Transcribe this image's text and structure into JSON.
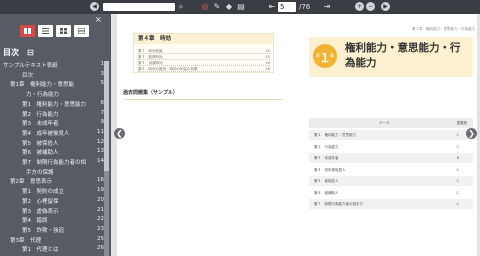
{
  "toolbar": {
    "page_number": "5",
    "page_total": "/76"
  },
  "sidebar": {
    "close_glyph": "×",
    "title": "目次",
    "toc": [
      {
        "label": "サンプルテキスト表紙",
        "page": "1",
        "indent": 0,
        "box": true
      },
      {
        "label": "目次",
        "page": "3",
        "indent": 2,
        "box": false
      },
      {
        "label": "第1章　権利能力・意思能",
        "page": "5",
        "indent": 1,
        "box": true
      },
      {
        "label": "力・行為能力",
        "page": "",
        "indent": 3,
        "box": false
      },
      {
        "label": "第1　権利能力・意思能力",
        "page": "6",
        "indent": 2,
        "box": false
      },
      {
        "label": "第2　行為能力",
        "page": "7",
        "indent": 2,
        "box": false
      },
      {
        "label": "第3　未成年者",
        "page": "9",
        "indent": 2,
        "box": false
      },
      {
        "label": "第4　成年被後見人",
        "page": "11",
        "indent": 2,
        "box": false
      },
      {
        "label": "第5　被保佐人",
        "page": "12",
        "indent": 2,
        "box": false
      },
      {
        "label": "第6　被補助人",
        "page": "13",
        "indent": 2,
        "box": false
      },
      {
        "label": "第7　制限行為能力者の相",
        "page": "14",
        "indent": 2,
        "box": false
      },
      {
        "label": "手方の保護",
        "page": "",
        "indent": 3,
        "box": false
      },
      {
        "label": "第2章　意思表示",
        "page": "16",
        "indent": 1,
        "box": true
      },
      {
        "label": "第1　契約の成立",
        "page": "19",
        "indent": 2,
        "box": false
      },
      {
        "label": "第2　心裡留保",
        "page": "20",
        "indent": 2,
        "box": false
      },
      {
        "label": "第3　虚偽表示",
        "page": "21",
        "indent": 2,
        "box": false
      },
      {
        "label": "第4　錯誤",
        "page": "22",
        "indent": 2,
        "box": false
      },
      {
        "label": "第5　詐欺・強迫",
        "page": "23",
        "indent": 2,
        "box": false
      },
      {
        "label": "第3章　代理",
        "page": "25",
        "indent": 1,
        "box": true
      },
      {
        "label": "第1　代理とは",
        "page": "26",
        "indent": 2,
        "box": false
      }
    ]
  },
  "left_page": {
    "chapter_header": "第４章　時効",
    "chapter_lines": [
      {
        "label": "第１　時効総論",
        "page": "44"
      },
      {
        "label": "第２　取得時効",
        "page": "45"
      },
      {
        "label": "第３　消滅時効",
        "page": "46"
      },
      {
        "label": "第４　時効の援用・時効の利益の放棄",
        "page": "48"
      }
    ],
    "reference_title": "過去問題集（サンプル）"
  },
  "right_page": {
    "running_head": "第１章　権利能力・意思能力・行為能力",
    "badge_small": "第",
    "badge_number": "１",
    "badge_suffix": "章",
    "chapter_title": "権利能力・意思能力・行為能力",
    "table_header": {
      "theme": "テーマ",
      "importance": "重要度"
    },
    "table_rows": [
      {
        "theme": "第１　権利能力・意思能力",
        "rank": "C"
      },
      {
        "theme": "第２　行為能力",
        "rank": "C"
      },
      {
        "theme": "第３　未成年者",
        "rank": "B"
      },
      {
        "theme": "第４　成年被後見人",
        "rank": "C"
      },
      {
        "theme": "第５　被保佐人",
        "rank": "C"
      },
      {
        "theme": "第６　被補助人",
        "rank": "C"
      },
      {
        "theme": "第７　制限行為能力者の相手方",
        "rank": "C"
      }
    ]
  }
}
